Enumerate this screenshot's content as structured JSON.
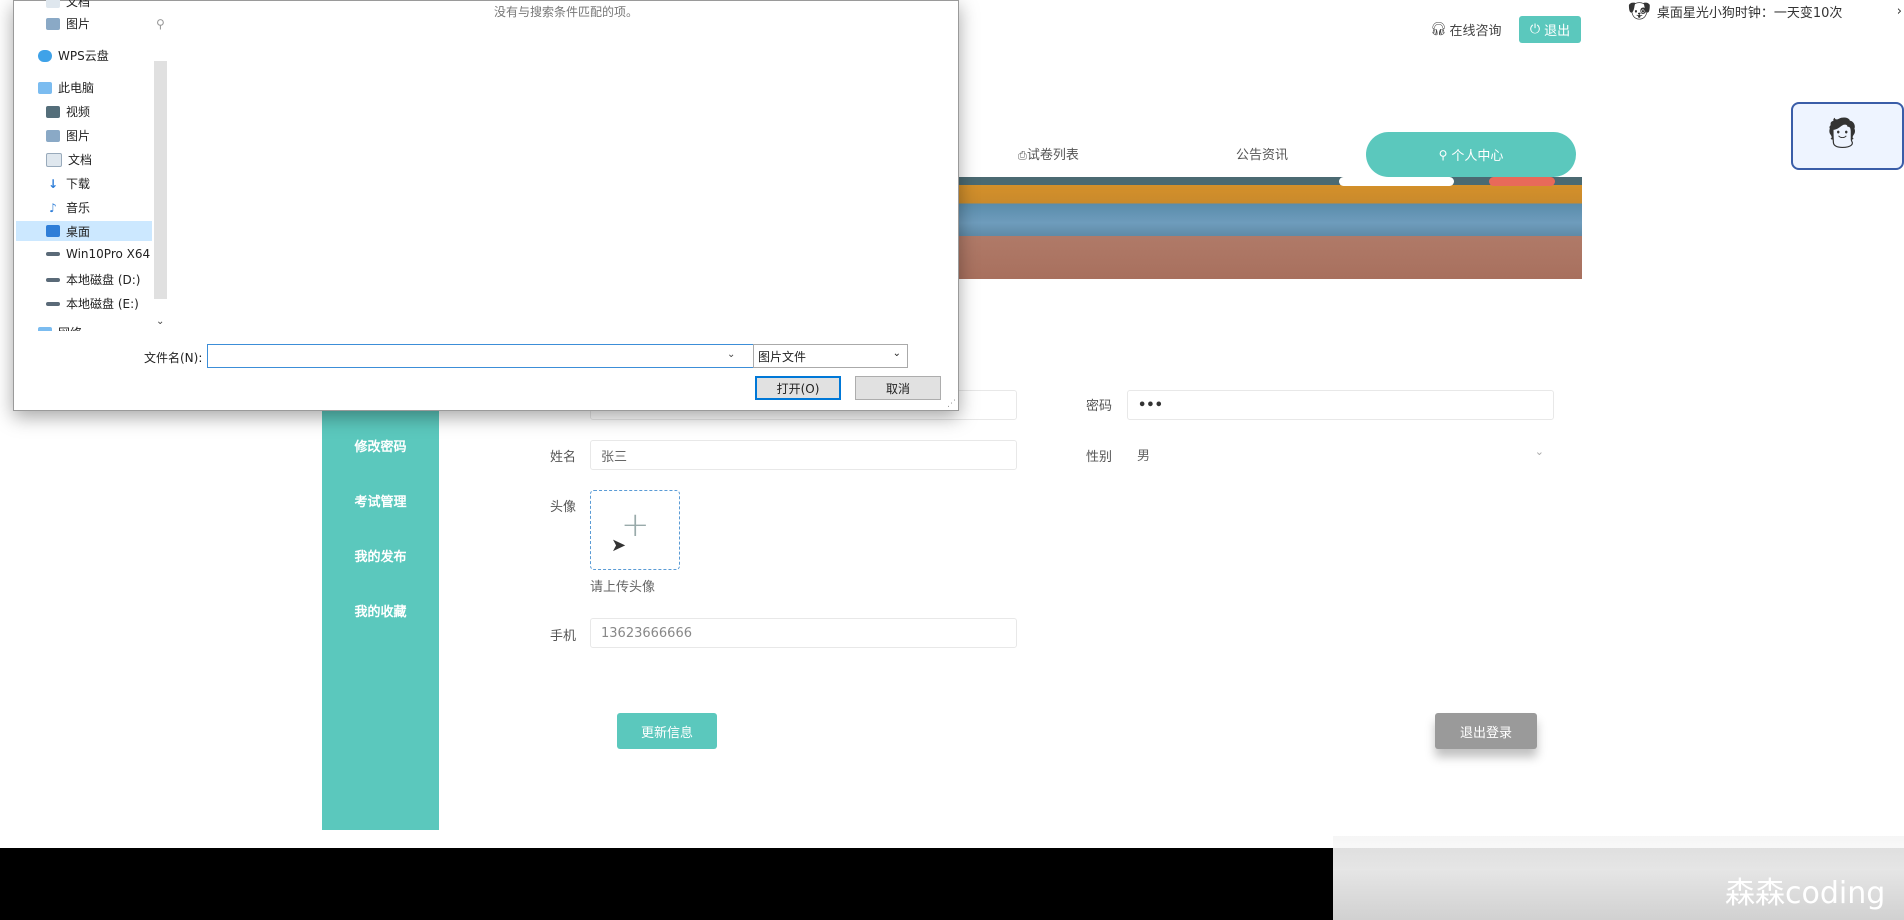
{
  "topbar": {
    "consult": "在线咨询",
    "logout": "退出"
  },
  "nav": {
    "items": [
      "试卷列表",
      "公告资讯"
    ],
    "active": "个人中心"
  },
  "sidebar": {
    "items": [
      "修改密码",
      "考试管理",
      "我的发布",
      "我的收藏"
    ]
  },
  "form": {
    "password_label": "密码",
    "password_value": "•••",
    "name_label": "姓名",
    "name_value": "张三",
    "gender_label": "性别",
    "gender_value": "男",
    "avatar_label": "头像",
    "upload_hint": "请上传头像",
    "phone_label": "手机",
    "phone_value": "13623666666",
    "update_button": "更新信息",
    "logout_button": "退出登录"
  },
  "widget": {
    "tip_text": "桌面星光小狗时钟：一天变10次",
    "arrow": "›"
  },
  "watermark": "森森coding",
  "dialog": {
    "tree": [
      {
        "label": "文档",
        "icon": "document-icon"
      },
      {
        "label": "图片",
        "icon": "picture-icon"
      },
      {
        "label": "WPS云盘",
        "icon": "cloud-icon"
      },
      {
        "label": "此电脑",
        "icon": "computer-icon"
      },
      {
        "label": "视频",
        "icon": "video-icon"
      },
      {
        "label": "图片",
        "icon": "picture-icon"
      },
      {
        "label": "文档",
        "icon": "document-icon"
      },
      {
        "label": "下载",
        "icon": "download-icon"
      },
      {
        "label": "音乐",
        "icon": "music-icon"
      },
      {
        "label": "桌面",
        "icon": "desktop-icon"
      },
      {
        "label": "Win10Pro X64",
        "icon": "drive-icon"
      },
      {
        "label": "本地磁盘 (D:)",
        "icon": "drive-icon"
      },
      {
        "label": "本地磁盘 (E:)",
        "icon": "drive-icon"
      },
      {
        "label": "网络",
        "icon": "network-icon"
      }
    ],
    "empty_message": "没有与搜索条件匹配的项。",
    "filename_label": "文件名(N):",
    "filename_value": "",
    "filetype_value": "图片文件",
    "open_button": "打开(O)",
    "cancel_button": "取消"
  },
  "colors": {
    "accent": "#5bc8bd",
    "dialog_focus": "#0078d7"
  }
}
